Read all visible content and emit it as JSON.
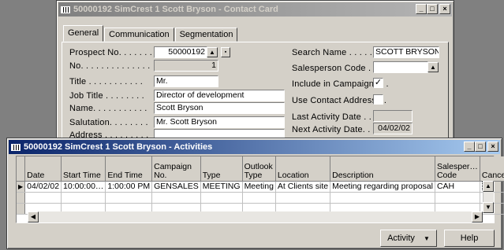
{
  "contact_card": {
    "title": "50000192 SimCrest 1 Scott Bryson - Contact Card",
    "window_buttons": {
      "minimize": "_",
      "maximize": "□",
      "close": "×"
    },
    "tabs": [
      "General",
      "Communication",
      "Segmentation"
    ],
    "selected_tab": "General",
    "left_fields": {
      "prospect_no": {
        "label": "Prospect No. . . . . . . .",
        "value": "50000192"
      },
      "no": {
        "label": "No. . . . . . . . . . . . . .",
        "value": "1"
      },
      "title": {
        "label": "Title . . . . . . . . . . .",
        "value": "Mr."
      },
      "job_title": {
        "label": "Job Title . . . . . . . .",
        "value": "Director of development"
      },
      "name": {
        "label": "Name. . . . . . . . . . .",
        "value": "Scott Bryson"
      },
      "salutation": {
        "label": "Salutation. . . . . . . .",
        "value": "Mr. Scott Bryson"
      },
      "address": {
        "label": "Address . . . . . . . . .",
        "value": ""
      }
    },
    "right_fields": {
      "search_name": {
        "label": "Search Name . . . . . . .",
        "value": "SCOTT BRYSON"
      },
      "salesperson_code": {
        "label": "Salesperson Code . . . .",
        "value": ""
      },
      "include_in_campaigns": {
        "label": "Include in Campaigns . .",
        "checked": true,
        "mark": "✓"
      },
      "use_contact_address": {
        "label": "Use Contact Address . .",
        "checked": false,
        "mark": ""
      },
      "last_activity_date": {
        "label": "Last Activity Date . . . .",
        "value": ""
      },
      "next_activity_date": {
        "label": "Next Activity Date. . . .",
        "value": "04/02/02"
      }
    }
  },
  "activities": {
    "title": "50000192 SimCrest 1 Scott Bryson - Activities",
    "window_buttons": {
      "minimize": "_",
      "maximize": "□",
      "close": "×"
    },
    "columns": [
      "Date",
      "Start Time",
      "End Time",
      "Campaign No.",
      "Type",
      "Outlook Type",
      "Location",
      "Description",
      "Salesper… Code",
      "Canceled"
    ],
    "rows": [
      [
        "04/02/02",
        "10:00:00…",
        "1:00:00 PM",
        "GENSALES",
        "MEETING",
        "Meeting",
        "At Clients site",
        "Meeting regarding proposal",
        "CAH",
        ""
      ]
    ],
    "row_marker": "▶",
    "buttons": {
      "activity": "Activity",
      "help": "Help"
    }
  }
}
